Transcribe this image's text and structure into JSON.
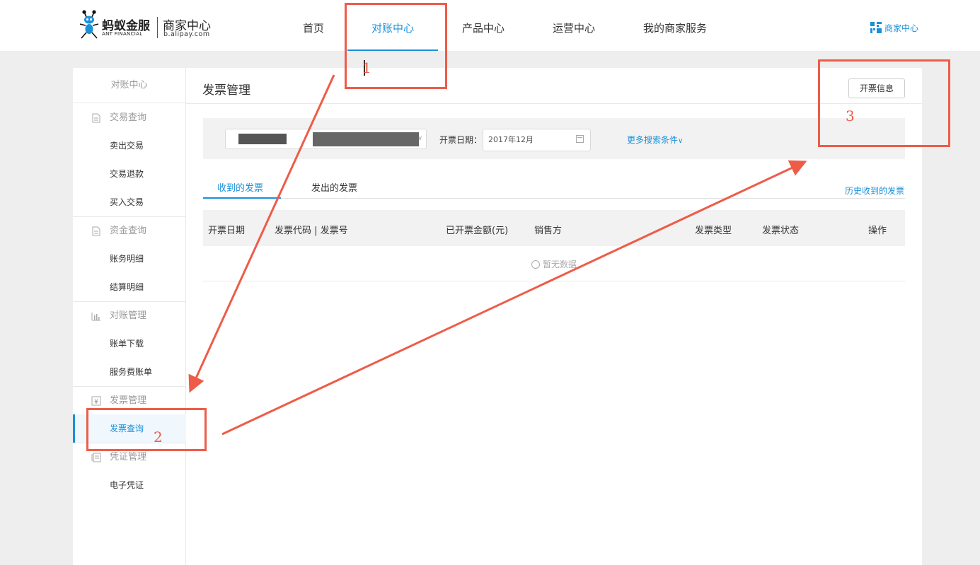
{
  "header": {
    "brand_cn": "蚂蚁金服",
    "brand_en": "ANT FINANCIAL",
    "site_cn": "商家中心",
    "site_url": "b.alipay.com",
    "nav": [
      "首页",
      "对账中心",
      "产品中心",
      "运营中心",
      "我的商家服务"
    ],
    "active_nav": "对账中心",
    "merchant_link": "商家中心"
  },
  "sidebar": {
    "title": "对账中心",
    "groups": [
      {
        "label": "交易查询",
        "icon": "document-icon",
        "items": [
          "卖出交易",
          "交易退款",
          "买入交易"
        ]
      },
      {
        "label": "资金查询",
        "icon": "document-icon",
        "items": [
          "账务明细",
          "结算明细"
        ]
      },
      {
        "label": "对账管理",
        "icon": "bar-chart-icon",
        "items": [
          "账单下载",
          "服务费账单"
        ]
      },
      {
        "label": "发票管理",
        "icon": "yen-icon",
        "items": [
          "发票查询"
        ]
      },
      {
        "label": "凭证管理",
        "icon": "voucher-icon",
        "items": [
          "电子凭证"
        ]
      }
    ],
    "active_item": "发票查询"
  },
  "main": {
    "title": "发票管理",
    "open_button": "开票信息",
    "search": {
      "date_label": "开票日期：",
      "date_value": "2017年12月",
      "more": "更多搜索条件"
    },
    "tabs": [
      "收到的发票",
      "发出的发票"
    ],
    "history_link": "历史收到的发票",
    "table": {
      "headers": [
        "开票日期",
        "发票代码 | 发票号",
        "已开票金额(元)",
        "销售方",
        "发票类型",
        "发票状态",
        "操作"
      ],
      "empty": "暂无数据"
    }
  },
  "annotations": {
    "labels": [
      "1",
      "2",
      "3"
    ],
    "color": "#ee5c48"
  },
  "colors": {
    "accent": "#1a90d8",
    "annotation": "#ee5c48"
  }
}
